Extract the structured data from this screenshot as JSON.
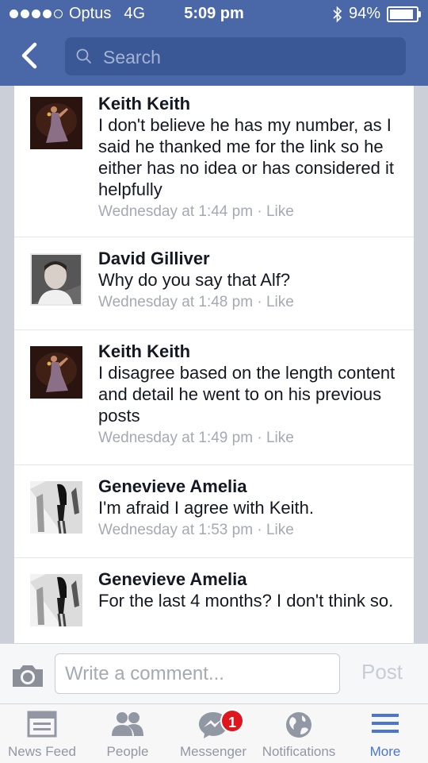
{
  "status_bar": {
    "carrier": "Optus",
    "network": "4G",
    "time": "5:09 pm",
    "battery": "94%",
    "signal_bars": 4
  },
  "nav": {
    "search_placeholder": "Search"
  },
  "comments": [
    {
      "author": "Keith Keith",
      "text": "I don't believe he has my number, as I said he thanked me for the link so he either has no idea or has considered it helpfully",
      "time": "Wednesday at 1:44 pm",
      "like_label": "Like"
    },
    {
      "author": "David Gilliver",
      "text": "Why do you say that Alf?",
      "time": "Wednesday at 1:48 pm",
      "like_label": "Like"
    },
    {
      "author": "Keith Keith",
      "text": "I disagree based on the length content and detail he went to on his previous posts",
      "time": "Wednesday at 1:49 pm",
      "like_label": "Like"
    },
    {
      "author": "Genevieve Amelia",
      "text": "I'm afraid I agree with Keith.",
      "time": "Wednesday at 1:53 pm",
      "like_label": "Like"
    },
    {
      "author": "Genevieve Amelia",
      "text": "For the last 4 months? I don't think so.",
      "time": "",
      "like_label": ""
    }
  ],
  "composer": {
    "placeholder": "Write a comment...",
    "post_label": "Post"
  },
  "tabs": [
    {
      "label": "News Feed",
      "icon": "news-feed-icon"
    },
    {
      "label": "People",
      "icon": "people-icon"
    },
    {
      "label": "Messenger",
      "icon": "messenger-icon",
      "badge": "1"
    },
    {
      "label": "Notifications",
      "icon": "globe-icon"
    },
    {
      "label": "More",
      "icon": "menu-icon"
    }
  ],
  "colors": {
    "header": "#4a67a7",
    "search_bg": "#3b5896",
    "active_tab": "#4a76cf",
    "badge": "#e0161f"
  }
}
